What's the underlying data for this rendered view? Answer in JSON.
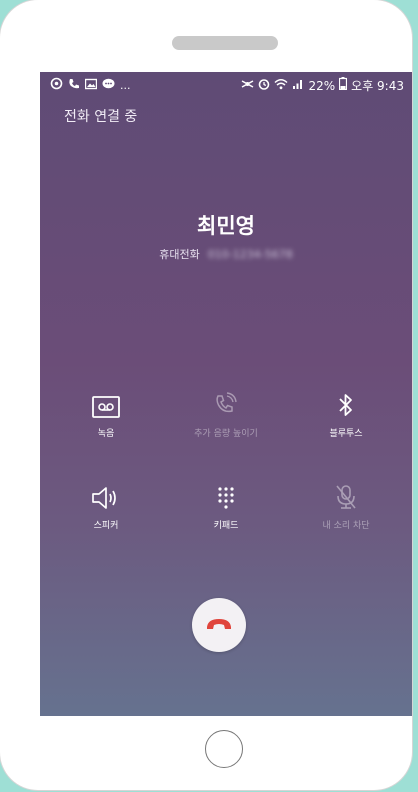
{
  "status_bar": {
    "left_icons": [
      "notification-icon",
      "phone-icon",
      "gallery-icon",
      "message-icon"
    ],
    "more": "...",
    "battery_percent": "22%",
    "time": "오후 9:43"
  },
  "call": {
    "status": "전화 연결 중",
    "contact_name": "최민영",
    "number_label": "휴대전화",
    "number_masked": "010-1234-5678"
  },
  "controls": [
    {
      "label": "녹음",
      "icon": "voicemail-record-icon",
      "enabled": true
    },
    {
      "label": "추가 음량 높이기",
      "icon": "volume-boost-phone-icon",
      "enabled": false
    },
    {
      "label": "블루투스",
      "icon": "bluetooth-icon",
      "enabled": true
    },
    {
      "label": "스피커",
      "icon": "speaker-icon",
      "enabled": true
    },
    {
      "label": "키패드",
      "icon": "keypad-icon",
      "enabled": true
    },
    {
      "label": "내 소리 차단",
      "icon": "mute-microphone-icon",
      "enabled": false
    }
  ],
  "end_call": {
    "icon": "end-call-icon",
    "color": "#e0453c"
  },
  "colors": {
    "page_background": "#9edfd5",
    "screen_top": "#5f4b75",
    "screen_bottom": "#66728f"
  }
}
